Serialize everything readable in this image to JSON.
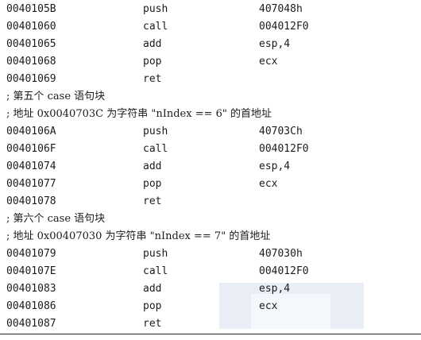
{
  "rows": [
    {
      "type": "code",
      "addr": "0040105B",
      "op": "push",
      "arg": "407048h"
    },
    {
      "type": "code",
      "addr": "00401060",
      "op": "call",
      "arg": "004012F0"
    },
    {
      "type": "code",
      "addr": "00401065",
      "op": "add",
      "arg": "esp,4"
    },
    {
      "type": "code",
      "addr": "00401068",
      "op": "pop",
      "arg": "ecx"
    },
    {
      "type": "code",
      "addr": "00401069",
      "op": "ret",
      "arg": ""
    },
    {
      "type": "comment",
      "text": "; 第五个 case 语句块"
    },
    {
      "type": "comment",
      "text": "; 地址 0x0040703C 为字符串 \"nIndex == 6\" 的首地址"
    },
    {
      "type": "code",
      "addr": "0040106A",
      "op": "push",
      "arg": "40703Ch"
    },
    {
      "type": "code",
      "addr": "0040106F",
      "op": "call",
      "arg": "004012F0"
    },
    {
      "type": "code",
      "addr": "00401074",
      "op": "add",
      "arg": "esp,4"
    },
    {
      "type": "code",
      "addr": "00401077",
      "op": "pop",
      "arg": "ecx"
    },
    {
      "type": "code",
      "addr": "00401078",
      "op": "ret",
      "arg": ""
    },
    {
      "type": "comment",
      "text": "; 第六个 case 语句块"
    },
    {
      "type": "comment",
      "text": "; 地址 0x00407030 为字符串 \"nIndex == 7\" 的首地址"
    },
    {
      "type": "code",
      "addr": "00401079",
      "op": "push",
      "arg": "407030h"
    },
    {
      "type": "code",
      "addr": "0040107E",
      "op": "call",
      "arg": "004012F0"
    },
    {
      "type": "code",
      "addr": "00401083",
      "op": "add",
      "arg": "esp,4"
    },
    {
      "type": "code",
      "addr": "00401086",
      "op": "pop",
      "arg": "ecx"
    },
    {
      "type": "code",
      "addr": "00401087",
      "op": "ret",
      "arg": ""
    }
  ]
}
